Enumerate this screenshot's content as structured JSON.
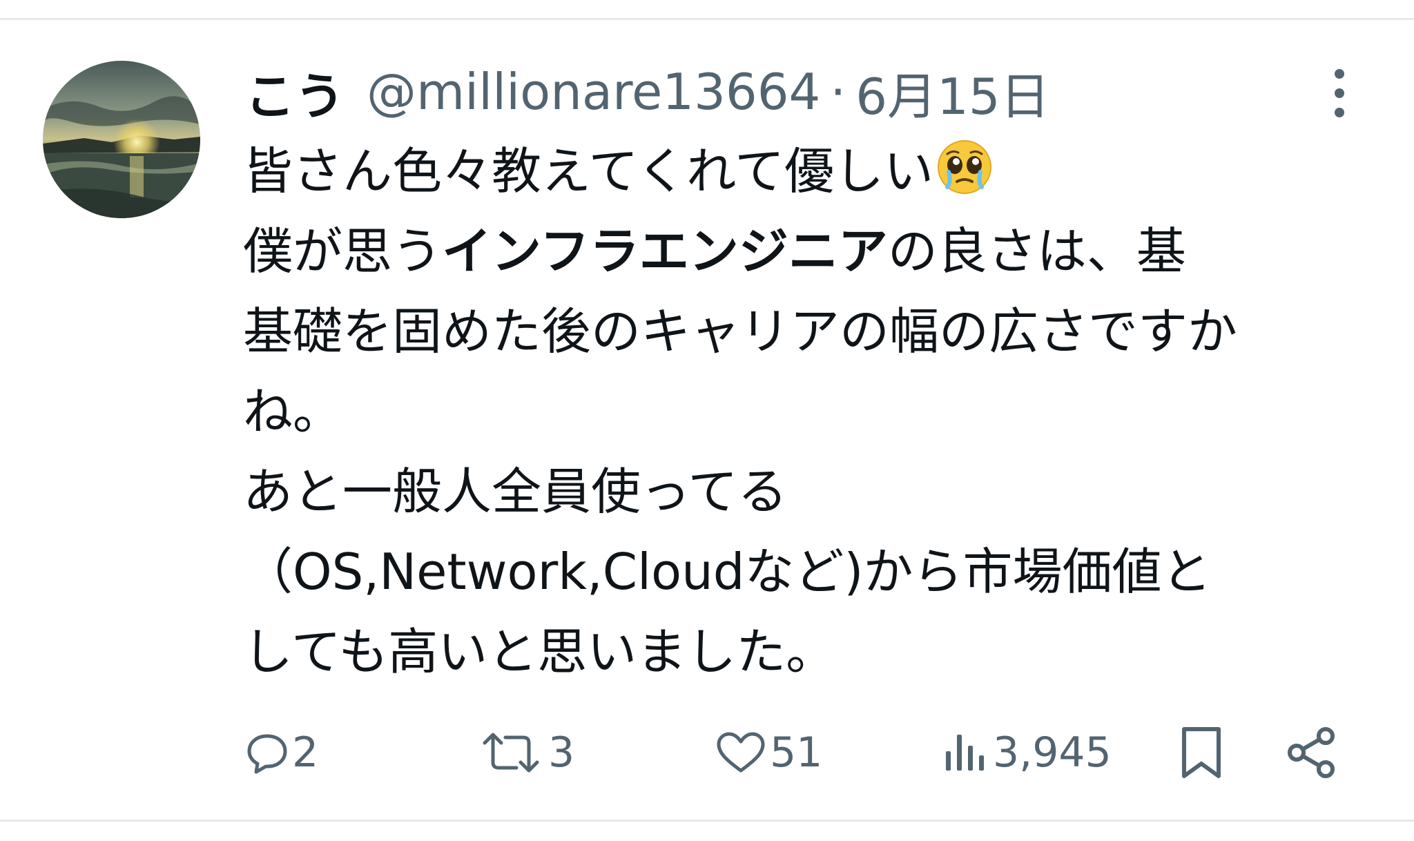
{
  "post": {
    "author": {
      "display_name": "こう",
      "handle": "@millionare13664",
      "separator": "·",
      "date": "6月15日"
    },
    "text_lines": [
      "皆さん色々教えてくれて優しい",
      "",
      "基礎を固めた後のキャリアの幅の広さですか",
      "ね。",
      "あと一般人全員使ってる",
      "（OS,Network,Cloudなど)から市場価値と",
      "しても高いと思いました。"
    ],
    "line2": {
      "before": "僕が思う",
      "bold": "インフラエンジニア",
      "after": "の良さは、基"
    },
    "emoji": "pleading-face-with-tears",
    "actions": {
      "replies": "2",
      "reposts": "3",
      "likes": "51",
      "views": "3,945"
    }
  },
  "colors": {
    "text": "#0f1419",
    "secondary": "#536471",
    "divider": "#e6e8ea"
  },
  "icons": [
    "more-vertical-icon",
    "reply-icon",
    "repost-icon",
    "like-icon",
    "views-icon",
    "bookmark-icon",
    "share-icon"
  ]
}
